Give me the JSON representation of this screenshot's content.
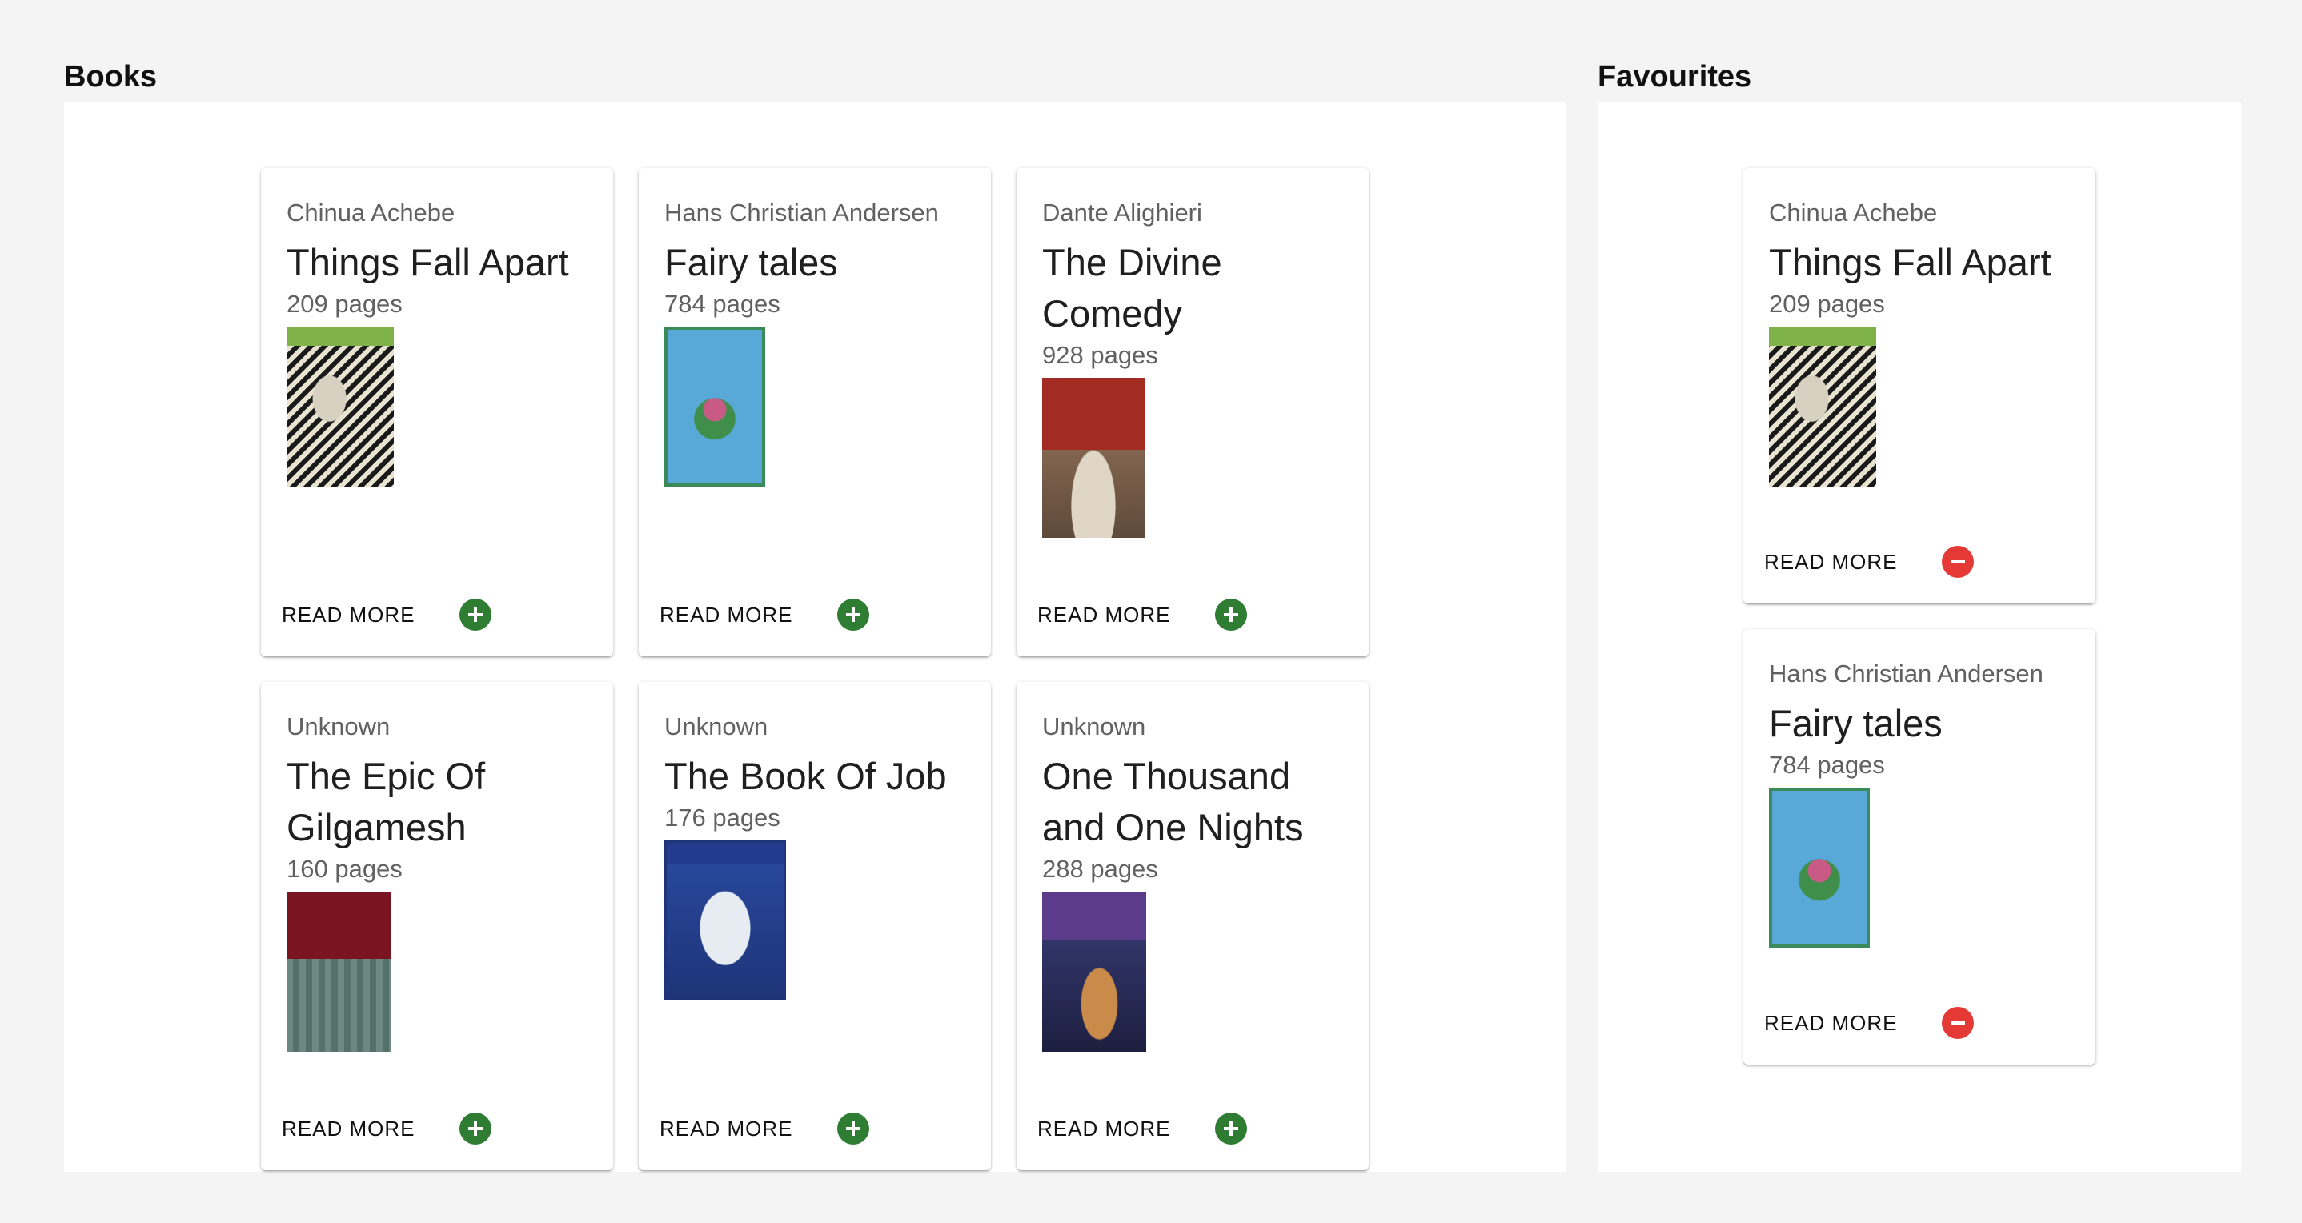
{
  "books_section": {
    "title": "Books",
    "items": [
      {
        "author": "Chinua Achebe",
        "title": "Things Fall Apart",
        "pages": "209 pages",
        "cover_icon": "things-fall-apart-cover",
        "read_more": "READ MORE",
        "action": "add"
      },
      {
        "author": "Hans Christian Andersen",
        "title": "Fairy tales",
        "pages": "784 pages",
        "cover_icon": "fairy-tales-cover",
        "read_more": "READ MORE",
        "action": "add"
      },
      {
        "author": "Dante Alighieri",
        "title": "The Divine Comedy",
        "pages": "928 pages",
        "cover_icon": "divine-comedy-cover",
        "read_more": "READ MORE",
        "action": "add"
      },
      {
        "author": "Unknown",
        "title": "The Epic Of Gilgamesh",
        "pages": "160 pages",
        "cover_icon": "gilgamesh-cover",
        "read_more": "READ MORE",
        "action": "add"
      },
      {
        "author": "Unknown",
        "title": "The Book Of Job",
        "pages": "176 pages",
        "cover_icon": "book-of-job-cover",
        "read_more": "READ MORE",
        "action": "add"
      },
      {
        "author": "Unknown",
        "title": "One Thousand and One Nights",
        "pages": "288 pages",
        "cover_icon": "arabian-nights-cover",
        "read_more": "READ MORE",
        "action": "add"
      }
    ]
  },
  "favourites_section": {
    "title": "Favourites",
    "items": [
      {
        "author": "Chinua Achebe",
        "title": "Things Fall Apart",
        "pages": "209 pages",
        "cover_icon": "things-fall-apart-cover",
        "read_more": "READ MORE",
        "action": "remove"
      },
      {
        "author": "Hans Christian Andersen",
        "title": "Fairy tales",
        "pages": "784 pages",
        "cover_icon": "fairy-tales-cover",
        "read_more": "READ MORE",
        "action": "remove"
      }
    ]
  },
  "colors": {
    "background": "#f4f4f4",
    "panel": "#ffffff",
    "add_button": "#2e7d32",
    "remove_button": "#e53935"
  }
}
